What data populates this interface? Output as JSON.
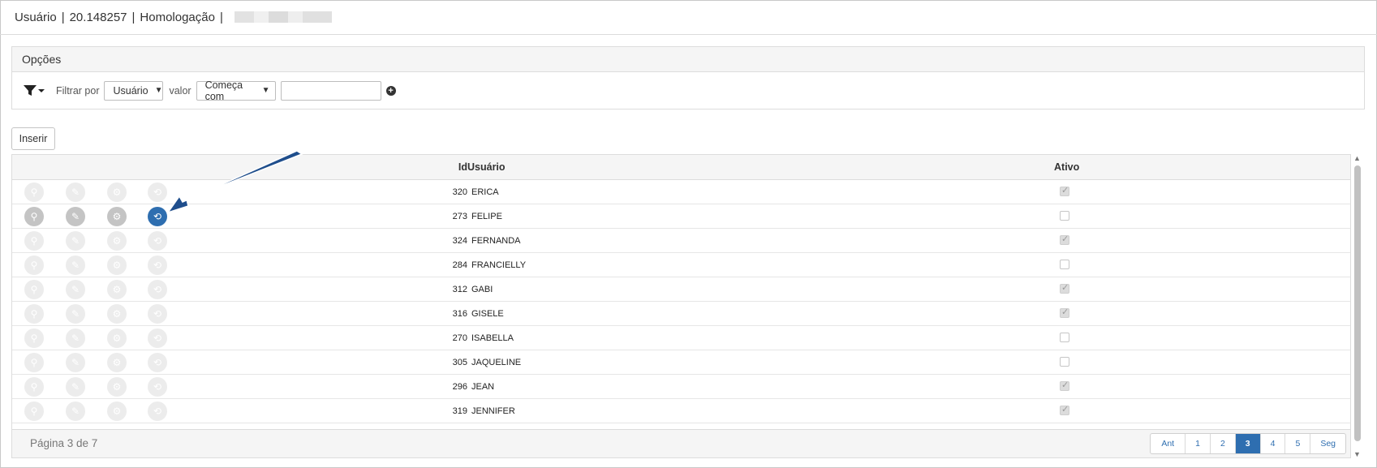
{
  "titlebar": {
    "entity": "Usuário",
    "code": "20.148257",
    "environment": "Homologação",
    "separator": "|"
  },
  "options": {
    "title": "Opções",
    "filter_by_label": "Filtrar por",
    "filter_field": "Usuário",
    "value_label": "valor",
    "condition": "Começa com",
    "value_input": "",
    "icons": {
      "filter": "filter-dropdown-icon",
      "add": "plus-circle-icon"
    }
  },
  "toolbar": {
    "insert_label": "Inserir"
  },
  "grid": {
    "columns": {
      "id": "Id",
      "user": "Usuário",
      "active": "Ativo"
    },
    "row_icons": [
      "search-icon",
      "pencil-icon",
      "gear-icon",
      "history-icon"
    ],
    "rows": [
      {
        "id": "320",
        "name": "ERICA",
        "active": true
      },
      {
        "id": "273",
        "name": "FELIPE",
        "active": false,
        "highlight": true
      },
      {
        "id": "324",
        "name": "FERNANDA",
        "active": true
      },
      {
        "id": "284",
        "name": "FRANCIELLY",
        "active": false
      },
      {
        "id": "312",
        "name": "GABI",
        "active": true
      },
      {
        "id": "316",
        "name": "GISELE",
        "active": true
      },
      {
        "id": "270",
        "name": "ISABELLA",
        "active": false
      },
      {
        "id": "305",
        "name": "JAQUELINE",
        "active": false
      },
      {
        "id": "296",
        "name": "JEAN",
        "active": true
      },
      {
        "id": "319",
        "name": "JENNIFER",
        "active": true
      }
    ],
    "footer": {
      "page_info": "Página 3 de 7",
      "pager": [
        "Ant",
        "1",
        "2",
        "3",
        "4",
        "5",
        "Seg"
      ],
      "current_page": "3"
    }
  },
  "colors": {
    "accent": "#2e6eb0",
    "arrow": "#1f4e8c"
  }
}
